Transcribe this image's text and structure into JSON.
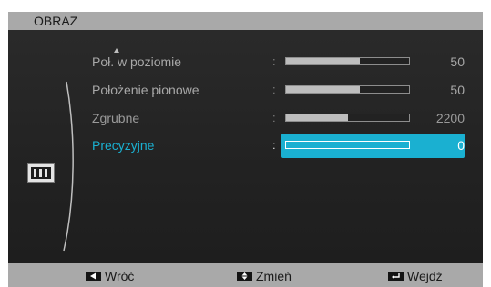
{
  "menu": {
    "title": "OBRAZ",
    "items": [
      {
        "label": "Poł. w poziomie",
        "value": "50",
        "level": 0.6
      },
      {
        "label": "Położenie pionowe",
        "value": "50",
        "level": 0.6
      },
      {
        "label": "Zgrubne",
        "value": "2200",
        "level": 0.5
      },
      {
        "label": "Precyzyjne",
        "value": "0",
        "level": 0.0
      }
    ],
    "separator": ":",
    "selected_index": 3
  },
  "footer": {
    "back_label": "Wróć",
    "change_label": "Zmień",
    "enter_label": "Wejdź"
  },
  "icons": {
    "category": "picture-menu-icon",
    "scroll": "scroll-up-arrow-icon"
  },
  "colors": {
    "highlight": "#1ab0d1",
    "bars": "#a9a9a9",
    "background": "#1c1c1c"
  }
}
